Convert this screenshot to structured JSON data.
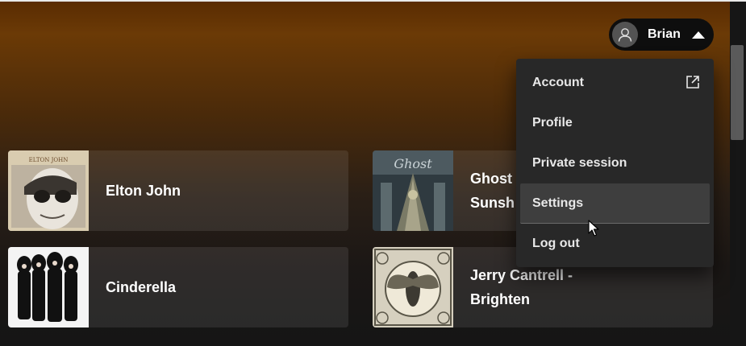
{
  "user_menu": {
    "user_name": "Brian",
    "items": [
      {
        "label": "Account",
        "icon": "external-link-icon"
      },
      {
        "label": "Profile"
      },
      {
        "label": "Private session"
      },
      {
        "label": "Settings",
        "hovered": true
      },
      {
        "label": "Log out"
      }
    ]
  },
  "shortcuts": [
    {
      "title": "Elton John",
      "cover": "elton-john-cover"
    },
    {
      "title": "Ghost - Impera / Sunshine",
      "title_line1": "Ghost",
      "title_line2": "Sunsh",
      "cover": "ghost-cover"
    },
    {
      "title": "Cinderella",
      "cover": "cinderella-cover"
    },
    {
      "title": "Jerry Cantrell - Brighten",
      "title_line1": "Jerry Cantrell -",
      "title_line2": "Brighten",
      "cover": "jerry-cantrell-cover"
    }
  ],
  "colors": {
    "header_gradient_top": "#6b3a06",
    "background": "#121212",
    "menu_background": "#282828",
    "menu_hover": "#3e3e3e",
    "card_background": "rgba(255,255,255,0.09)"
  }
}
